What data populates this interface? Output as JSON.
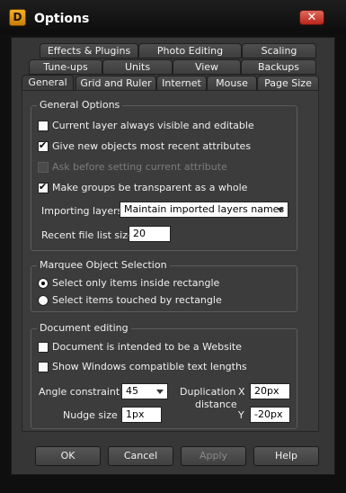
{
  "window": {
    "title": "Options",
    "app_icon_letter": "D",
    "close_symbol": "✕"
  },
  "tabs": {
    "row1": [
      "Effects & Plugins",
      "Photo Editing",
      "Scaling"
    ],
    "row2": [
      "Tune-ups",
      "Units",
      "View",
      "Backups"
    ],
    "row3": [
      "General",
      "Grid and Ruler",
      "Internet",
      "Mouse",
      "Page Size"
    ],
    "active": "General"
  },
  "general_options": {
    "title": "General Options",
    "current_layer_visible": {
      "label": "Current layer always visible and editable",
      "checked": false
    },
    "recent_attributes": {
      "label": "Give new objects most recent attributes",
      "checked": true
    },
    "ask_before_setting": {
      "label": "Ask before setting current attribute",
      "checked": false,
      "disabled": true
    },
    "groups_transparent": {
      "label": "Make groups be transparent as a whole",
      "checked": true
    },
    "importing_layers_label": "Importing layers",
    "importing_layers_value": "Maintain imported layers names",
    "recent_file_list_label": "Recent file list size",
    "recent_file_list_value": "20"
  },
  "marquee": {
    "title": "Marquee Object Selection",
    "options": [
      {
        "label": "Select only items inside rectangle",
        "checked": true
      },
      {
        "label": "Select items touched by rectangle",
        "checked": false
      }
    ]
  },
  "document_editing": {
    "title": "Document editing",
    "website": {
      "label": "Document is intended to be a Website",
      "checked": false
    },
    "windows_compatible": {
      "label": "Show Windows compatible text lengths",
      "checked": false
    },
    "angle_label": "Angle constraint",
    "angle_value": "45",
    "nudge_label": "Nudge size",
    "nudge_value": "1px",
    "duplication_label_1": "Duplication",
    "duplication_label_2": "distance",
    "dup_x_label": "X",
    "dup_x_value": "20px",
    "dup_y_label": "Y",
    "dup_y_value": "-20px"
  },
  "buttons": {
    "ok": "OK",
    "cancel": "Cancel",
    "apply": "Apply",
    "help": "Help"
  },
  "colors": {
    "background": "#363636",
    "panel": "#3c3c3c",
    "close_button": "#c8362a",
    "app_icon": "#f0a21d"
  }
}
